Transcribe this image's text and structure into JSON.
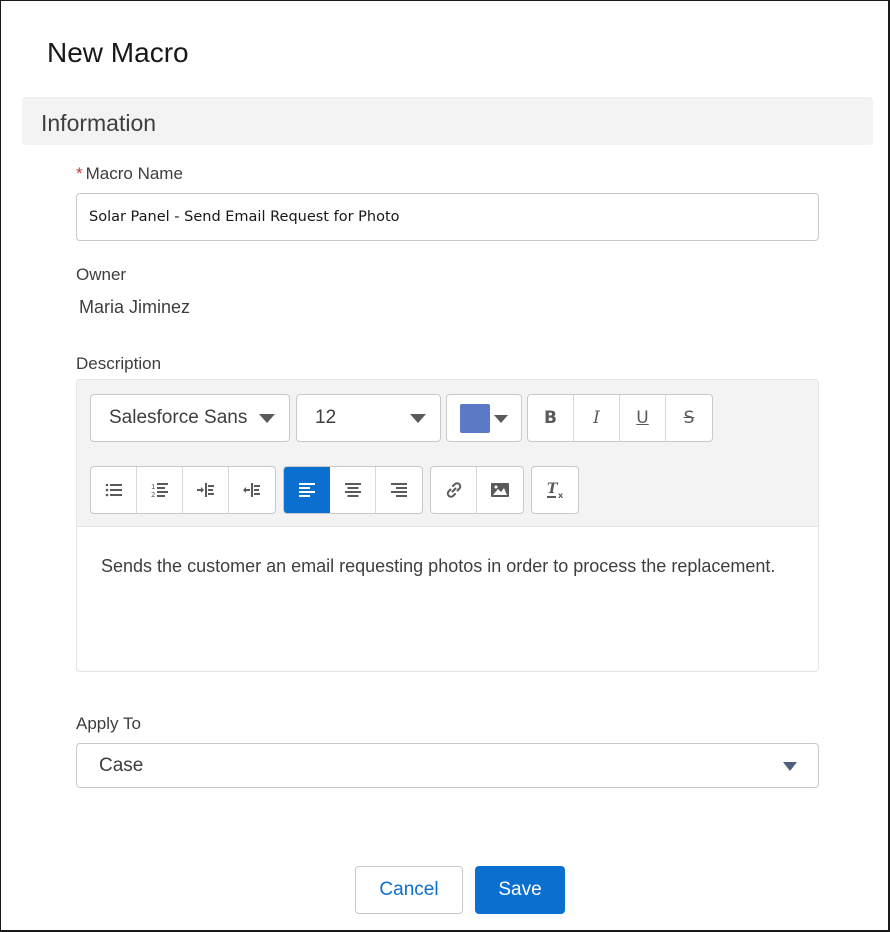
{
  "dialog": {
    "title": "New Macro",
    "section_title": "Information"
  },
  "fields": {
    "macro_name": {
      "required_marker": "*",
      "label": "Macro Name",
      "value": "Solar Panel - Send Email Request for Photo"
    },
    "owner": {
      "label": "Owner",
      "value": "Maria Jiminez"
    },
    "description": {
      "label": "Description",
      "toolbar": {
        "font_family": "Salesforce Sans",
        "font_size": "12",
        "text_color": "#5b79c4",
        "format_buttons": [
          "bold-icon",
          "italic-icon",
          "underline-icon",
          "strikethrough-icon"
        ],
        "format_labels": [
          "B",
          "I",
          "U",
          "S"
        ],
        "list_buttons": [
          "bulleted-list-icon",
          "numbered-list-icon",
          "indent-icon",
          "outdent-icon"
        ],
        "align_buttons": [
          "align-left-icon",
          "align-center-icon",
          "align-right-icon"
        ],
        "active_align": "left",
        "insert_buttons": [
          "link-icon",
          "image-icon"
        ],
        "clear_button": "clear-formatting-icon"
      },
      "value": "Sends the customer an email requesting photos in order to process the replacement."
    },
    "apply_to": {
      "label": "Apply To",
      "value": "Case"
    }
  },
  "footer": {
    "cancel_label": "Cancel",
    "save_label": "Save"
  },
  "colors": {
    "brand": "#0b6fd0",
    "required": "#c23934"
  }
}
